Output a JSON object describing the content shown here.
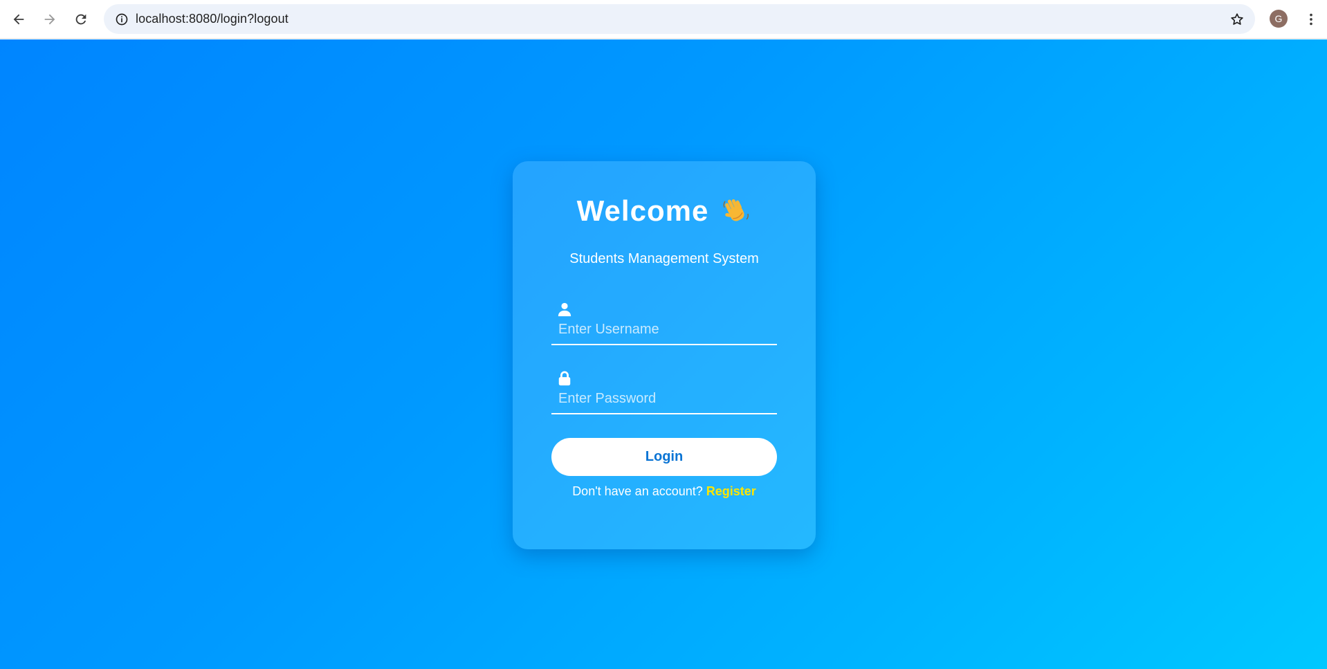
{
  "browser": {
    "url": "localhost:8080/login?logout",
    "avatar_initial": "G",
    "icons": [
      "back-icon",
      "forward-icon",
      "reload-icon",
      "site-info-icon",
      "bookmark-star-icon",
      "kebab-menu-icon"
    ]
  },
  "login": {
    "title": "Welcome",
    "title_emoji": "waving-hand-icon",
    "subtitle": "Students Management System",
    "username_placeholder": "Enter Username",
    "username_value": "",
    "password_placeholder": "Enter Password",
    "password_value": "",
    "login_label": "Login",
    "register_prompt": "Don't have an account?",
    "register_label": "Register"
  },
  "colors": {
    "gradient_start": "#0085ff",
    "gradient_end": "#00c8ff",
    "button_text": "#0a74d4",
    "register_link": "#ffe600"
  }
}
